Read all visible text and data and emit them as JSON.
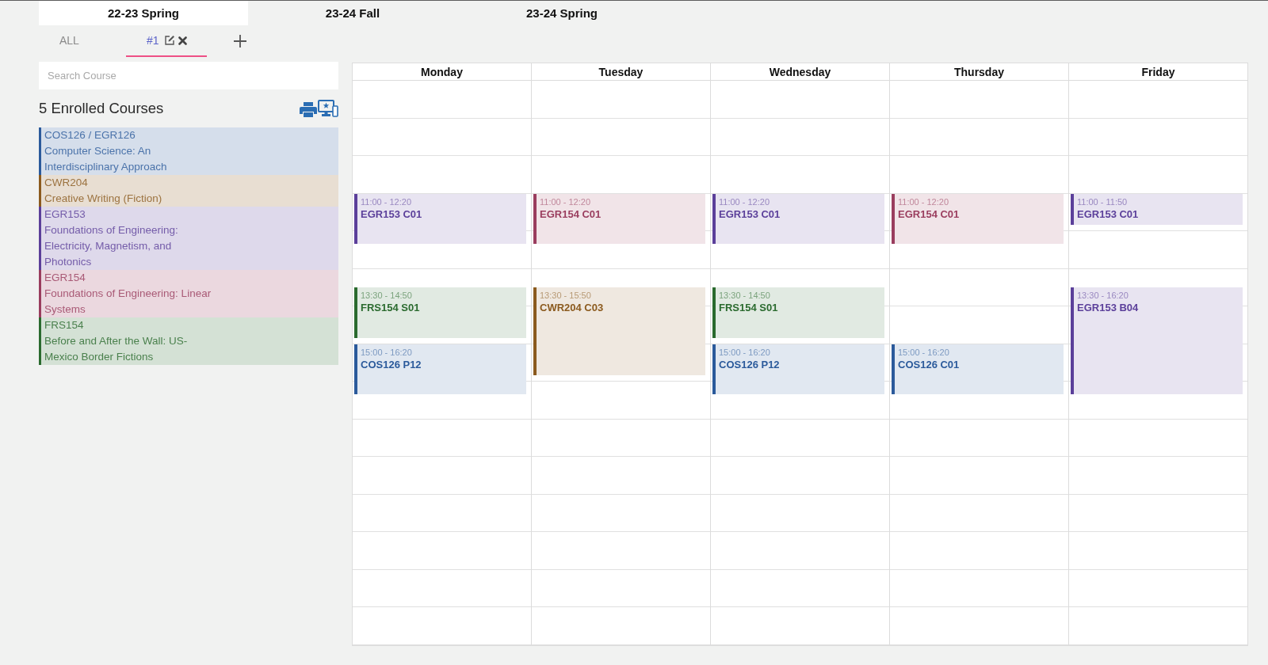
{
  "semester_tabs": [
    {
      "label": "22-23 Spring",
      "selected": true
    },
    {
      "label": "23-24 Fall",
      "selected": false
    },
    {
      "label": "23-24 Spring",
      "selected": false
    }
  ],
  "schedule_tabs": [
    {
      "label": "ALL",
      "selected": false,
      "kind": "fixed"
    },
    {
      "label": "#1",
      "selected": true,
      "kind": "editable"
    }
  ],
  "search": {
    "placeholder": "Search Course"
  },
  "enrolled": {
    "heading": "5 Enrolled Courses",
    "courses": [
      {
        "code": "COS126 / EGR126",
        "title": "Computer Science: An Interdisciplinary Approach",
        "color": "#2b5a9b"
      },
      {
        "code": "CWR204",
        "title": "Creative Writing (Fiction)",
        "color": "#8b5a1e"
      },
      {
        "code": "EGR153",
        "title": "Foundations of Engineering: Electricity, Magnetism, and Photonics",
        "color": "#5b3f9a"
      },
      {
        "code": "EGR154",
        "title": "Foundations of Engineering: Linear Systems",
        "color": "#9a3d5e"
      },
      {
        "code": "FRS154",
        "title": "Before and After the Wall: US-Mexico Border Fictions",
        "color": "#2a6a2e"
      }
    ]
  },
  "calendar": {
    "days": [
      {
        "name": "Monday",
        "events": [
          {
            "time": "11:00 - 12:20",
            "title": "EGR153 C01",
            "color": "#5b3f9a"
          },
          {
            "time": "13:30 - 14:50",
            "title": "FRS154 S01",
            "color": "#2a6a2e"
          },
          {
            "time": "15:00 - 16:20",
            "title": "COS126 P12",
            "color": "#2b5a9b"
          }
        ]
      },
      {
        "name": "Tuesday",
        "events": [
          {
            "time": "11:00 - 12:20",
            "title": "EGR154 C01",
            "color": "#9a3d5e"
          },
          {
            "time": "13:30 - 15:50",
            "title": "CWR204 C03",
            "color": "#8b5a1e"
          }
        ]
      },
      {
        "name": "Wednesday",
        "events": [
          {
            "time": "11:00 - 12:20",
            "title": "EGR153 C01",
            "color": "#5b3f9a"
          },
          {
            "time": "13:30 - 14:50",
            "title": "FRS154 S01",
            "color": "#2a6a2e"
          },
          {
            "time": "15:00 - 16:20",
            "title": "COS126 P12",
            "color": "#2b5a9b"
          }
        ]
      },
      {
        "name": "Thursday",
        "events": [
          {
            "time": "11:00 - 12:20",
            "title": "EGR154 C01",
            "color": "#9a3d5e"
          },
          {
            "time": "15:00 - 16:20",
            "title": "COS126 C01",
            "color": "#2b5a9b"
          }
        ]
      },
      {
        "name": "Friday",
        "events": [
          {
            "time": "11:00 - 11:50",
            "title": "EGR153 C01",
            "color": "#5b3f9a"
          },
          {
            "time": "13:30 - 16:20",
            "title": "EGR153 B04",
            "color": "#5b3f9a"
          }
        ]
      }
    ]
  }
}
